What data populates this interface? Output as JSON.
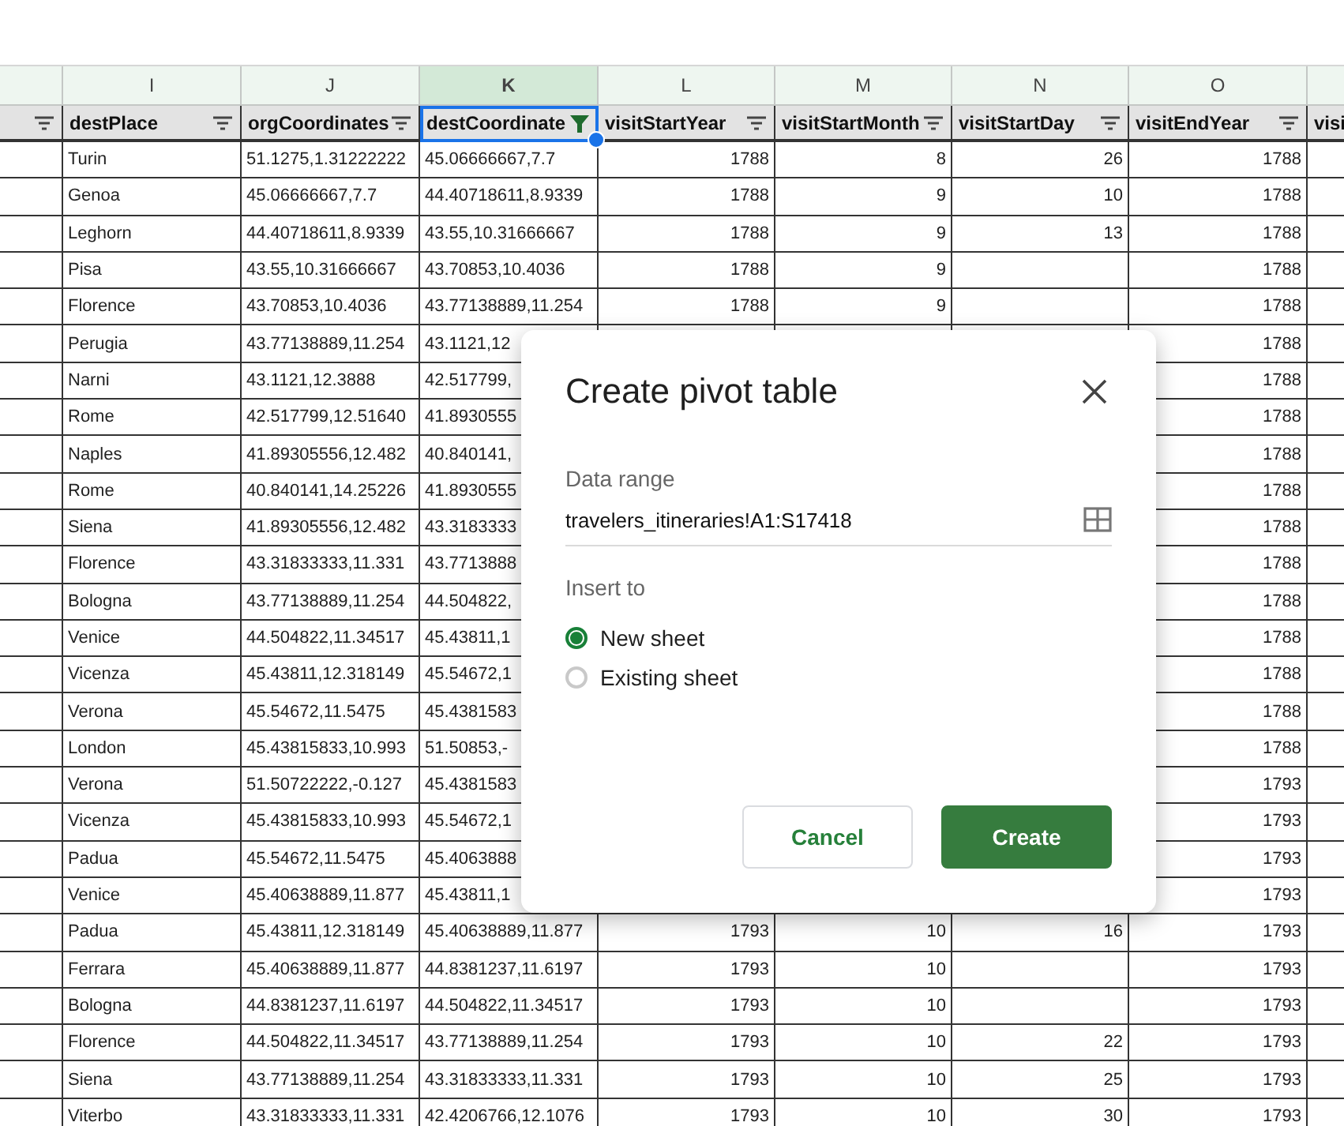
{
  "sheet": {
    "columns": [
      {
        "filtered": false,
        "selected": false
      },
      {
        "letter": "I",
        "header": "destPlace",
        "filtered": false,
        "selected": false,
        "numeric": false
      },
      {
        "letter": "J",
        "header": "orgCoordinates",
        "filtered": false,
        "selected": false,
        "numeric": false
      },
      {
        "letter": "K",
        "header": "destCoordinate",
        "filtered": true,
        "selected": true,
        "numeric": false
      },
      {
        "letter": "L",
        "header": "visitStartYear",
        "filtered": false,
        "selected": false,
        "numeric": true
      },
      {
        "letter": "M",
        "header": "visitStartMonth",
        "filtered": false,
        "selected": false,
        "numeric": true
      },
      {
        "letter": "N",
        "header": "visitStartDay",
        "filtered": false,
        "selected": false,
        "numeric": true
      },
      {
        "letter": "O",
        "header": "visitEndYear",
        "filtered": false,
        "selected": false,
        "numeric": true
      },
      {
        "header": "visi",
        "selected": false
      }
    ],
    "rows": [
      {
        "I": "Turin",
        "J": "51.1275,1.31222222",
        "K": "45.06666667,7.7",
        "L": "1788",
        "M": "8",
        "N": "26",
        "O": "1788"
      },
      {
        "I": "Genoa",
        "J": "45.06666667,7.7",
        "K": "44.40718611,8.9339",
        "L": "1788",
        "M": "9",
        "N": "10",
        "O": "1788"
      },
      {
        "I": "Leghorn",
        "J": "44.40718611,8.9339",
        "K": "43.55,10.31666667",
        "L": "1788",
        "M": "9",
        "N": "13",
        "O": "1788"
      },
      {
        "I": "Pisa",
        "J": "43.55,10.31666667",
        "K": "43.70853,10.4036",
        "L": "1788",
        "M": "9",
        "O": "1788"
      },
      {
        "I": "Florence",
        "J": "43.70853,10.4036",
        "K": "43.77138889,11.254",
        "L": "1788",
        "M": "9",
        "O": "1788"
      },
      {
        "I": "Perugia",
        "J": "43.77138889,11.254",
        "K": "43.1121,12",
        "O": "1788"
      },
      {
        "I": "Narni",
        "J": "43.1121,12.3888",
        "K": "42.517799,",
        "O": "1788"
      },
      {
        "I": "Rome",
        "J": "42.517799,12.51640",
        "K": "41.8930555",
        "O": "1788"
      },
      {
        "I": "Naples",
        "J": "41.89305556,12.482",
        "K": "40.840141,",
        "O": "1788"
      },
      {
        "I": "Rome",
        "J": "40.840141,14.25226",
        "K": "41.8930555",
        "O": "1788"
      },
      {
        "I": "Siena",
        "J": "41.89305556,12.482",
        "K": "43.3183333",
        "O": "1788"
      },
      {
        "I": "Florence",
        "J": "43.31833333,11.331",
        "K": "43.7713888",
        "O": "1788"
      },
      {
        "I": "Bologna",
        "J": "43.77138889,11.254",
        "K": "44.504822,",
        "O": "1788"
      },
      {
        "I": "Venice",
        "J": "44.504822,11.34517",
        "K": "45.43811,1",
        "O": "1788"
      },
      {
        "I": "Vicenza",
        "J": "45.43811,12.318149",
        "K": "45.54672,1",
        "O": "1788"
      },
      {
        "I": "Verona",
        "J": "45.54672,11.5475",
        "K": "45.4381583",
        "O": "1788"
      },
      {
        "I": "London",
        "J": "45.43815833,10.993",
        "K": "51.50853,-",
        "O": "1788"
      },
      {
        "I": "Verona",
        "J": "51.50722222,-0.127",
        "K": "45.4381583",
        "O": "1793"
      },
      {
        "I": "Vicenza",
        "J": "45.43815833,10.993",
        "K": "45.54672,1",
        "O": "1793"
      },
      {
        "I": "Padua",
        "J": "45.54672,11.5475",
        "K": "45.4063888",
        "O": "1793"
      },
      {
        "I": "Venice",
        "J": "45.40638889,11.877",
        "K": "45.43811,1",
        "O": "1793"
      },
      {
        "I": "Padua",
        "J": "45.43811,12.318149",
        "K": "45.40638889,11.877",
        "L": "1793",
        "M": "10",
        "N": "16",
        "O": "1793"
      },
      {
        "I": "Ferrara",
        "J": "45.40638889,11.877",
        "K": "44.8381237,11.6197",
        "L": "1793",
        "M": "10",
        "O": "1793"
      },
      {
        "I": "Bologna",
        "J": "44.8381237,11.6197",
        "K": "44.504822,11.34517",
        "L": "1793",
        "M": "10",
        "O": "1793"
      },
      {
        "I": "Florence",
        "J": "44.504822,11.34517",
        "K": "43.77138889,11.254",
        "L": "1793",
        "M": "10",
        "N": "22",
        "O": "1793"
      },
      {
        "I": "Siena",
        "J": "43.77138889,11.254",
        "K": "43.31833333,11.331",
        "L": "1793",
        "M": "10",
        "N": "25",
        "O": "1793"
      },
      {
        "I": "Viterbo",
        "J": "43.31833333,11.331",
        "K": "42.4206766,12.1076",
        "L": "1793",
        "M": "10",
        "N": "30",
        "O": "1793"
      }
    ]
  },
  "dialog": {
    "title": "Create pivot table",
    "data_range": {
      "label": "Data range",
      "value": "travelers_itineraries!A1:S17418"
    },
    "insert_to": {
      "label": "Insert to",
      "options": [
        {
          "label": "New sheet",
          "selected": true
        },
        {
          "label": "Existing sheet",
          "selected": false
        }
      ]
    },
    "buttons": [
      {
        "label": "Cancel",
        "primary": false
      },
      {
        "label": "Create",
        "primary": true
      }
    ]
  }
}
